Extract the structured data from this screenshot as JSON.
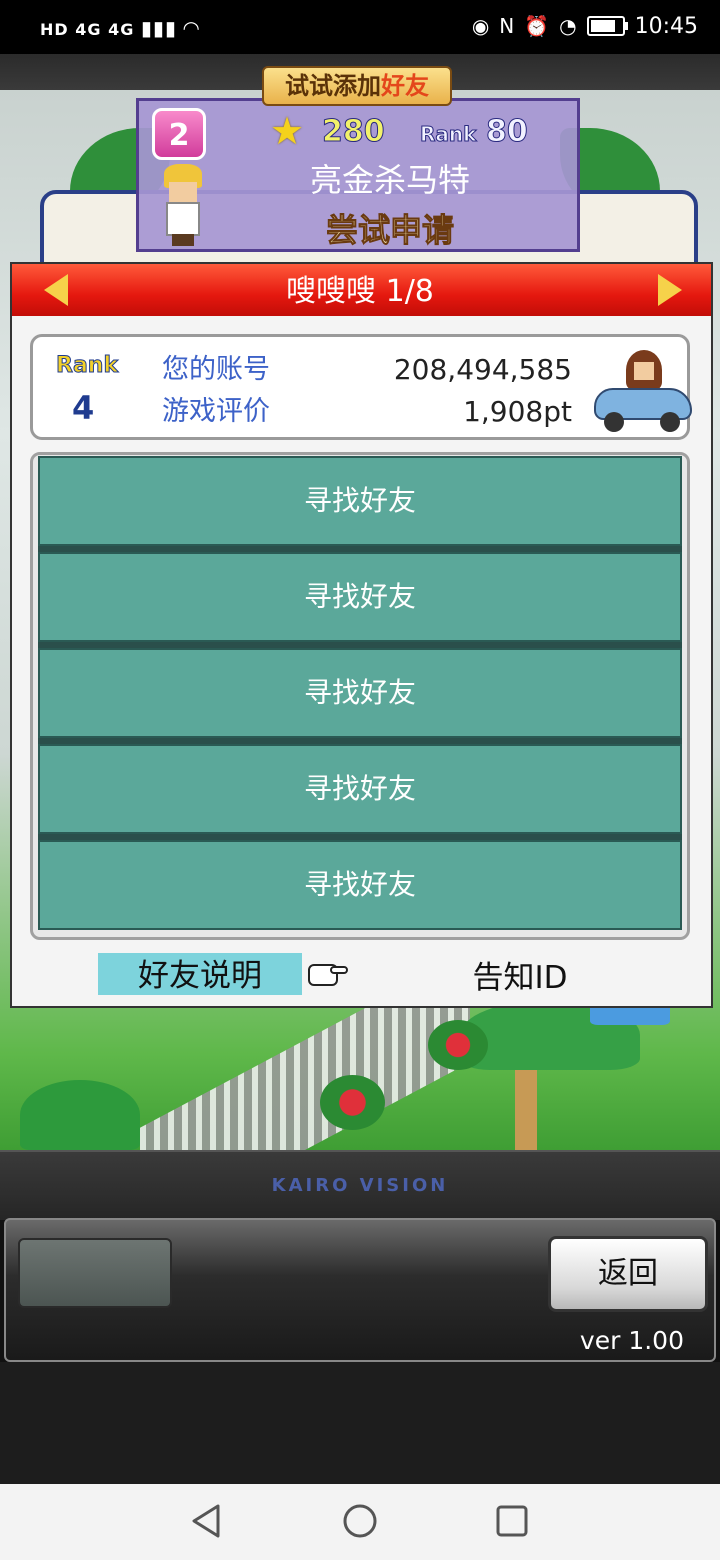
{
  "status_bar": {
    "left_icons": "HD 4G 4G",
    "time": "10:45",
    "icons": [
      "eye-icon",
      "nfc-icon",
      "alarm-icon",
      "speed-icon",
      "battery-icon",
      "wifi-icon"
    ]
  },
  "promo": {
    "ribbon_prefix": "试试添加",
    "ribbon_highlight": "好友",
    "level": "2",
    "stars": "280",
    "rank_label": "Rank",
    "rank_value": "80",
    "name": "亮金杀马特",
    "apply_label": "尝试申请"
  },
  "panel": {
    "title": "嗖嗖嗖 1/8",
    "account": {
      "rank_label": "Rank",
      "rank_value": "4",
      "label_account": "您的账号",
      "value_account": "208,494,585",
      "label_rating": "游戏评价",
      "value_rating": "1,908pt"
    },
    "slots": [
      "寻找好友",
      "寻找好友",
      "寻找好友",
      "寻找好友",
      "寻找好友"
    ],
    "friend_help": "好友说明",
    "notify_id": "告知ID"
  },
  "hud": {
    "brand": "KAIRO VISION",
    "back_label": "返回",
    "version": "ver 1.00"
  },
  "colors": {
    "header_red": "#e5180f",
    "slot_teal": "#5ba89a",
    "label_blue": "#3d62c8",
    "help_highlight": "#7dd3dc"
  }
}
